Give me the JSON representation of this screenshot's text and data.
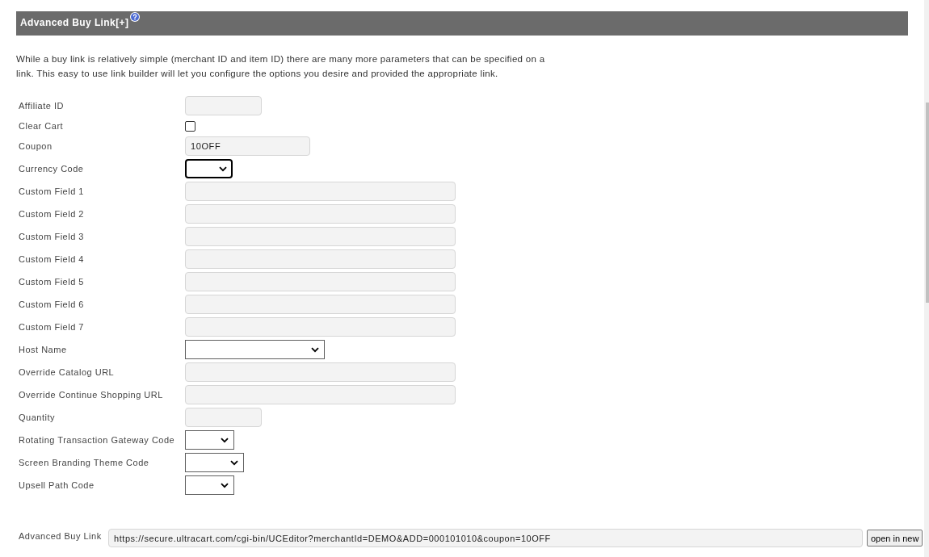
{
  "section": {
    "title": "Advanced Buy Link[+]",
    "description": "While a buy link is relatively simple (merchant ID and item ID) there are many more parameters that can be specified on a link. This easy to use link builder will let you configure the options you desire and provided the appropriate link."
  },
  "fields": [
    {
      "label": "Affiliate ID",
      "kind": "text"
    },
    {
      "label": "Clear Cart",
      "kind": "checkbox",
      "checked": false
    },
    {
      "label": "Coupon",
      "kind": "text",
      "value": "10OFF"
    },
    {
      "label": "Currency Code",
      "kind": "select",
      "focused": true
    },
    {
      "label": "Custom Field 1",
      "kind": "text"
    },
    {
      "label": "Custom Field 2",
      "kind": "text"
    },
    {
      "label": "Custom Field 3",
      "kind": "text"
    },
    {
      "label": "Custom Field 4",
      "kind": "text"
    },
    {
      "label": "Custom Field 5",
      "kind": "text"
    },
    {
      "label": "Custom Field 6",
      "kind": "text"
    },
    {
      "label": "Custom Field 7",
      "kind": "text"
    },
    {
      "label": "Host Name",
      "kind": "select",
      "focused": false
    },
    {
      "label": "Override Catalog URL",
      "kind": "text"
    },
    {
      "label": "Override Continue Shopping URL",
      "kind": "text"
    },
    {
      "label": "Quantity",
      "kind": "text"
    },
    {
      "label": "Rotating Transaction Gateway Code",
      "kind": "select",
      "focused": false
    },
    {
      "label": "Screen Branding Theme Code",
      "kind": "select",
      "focused": false
    },
    {
      "label": "Upsell Path Code",
      "kind": "select",
      "focused": false
    }
  ],
  "result": {
    "label": "Advanced Buy Link",
    "value": "https://secure.ultracart.com/cgi-bin/UCEditor?merchantId=DEMO&ADD=000101010&coupon=10OFF",
    "button": "open in new"
  }
}
